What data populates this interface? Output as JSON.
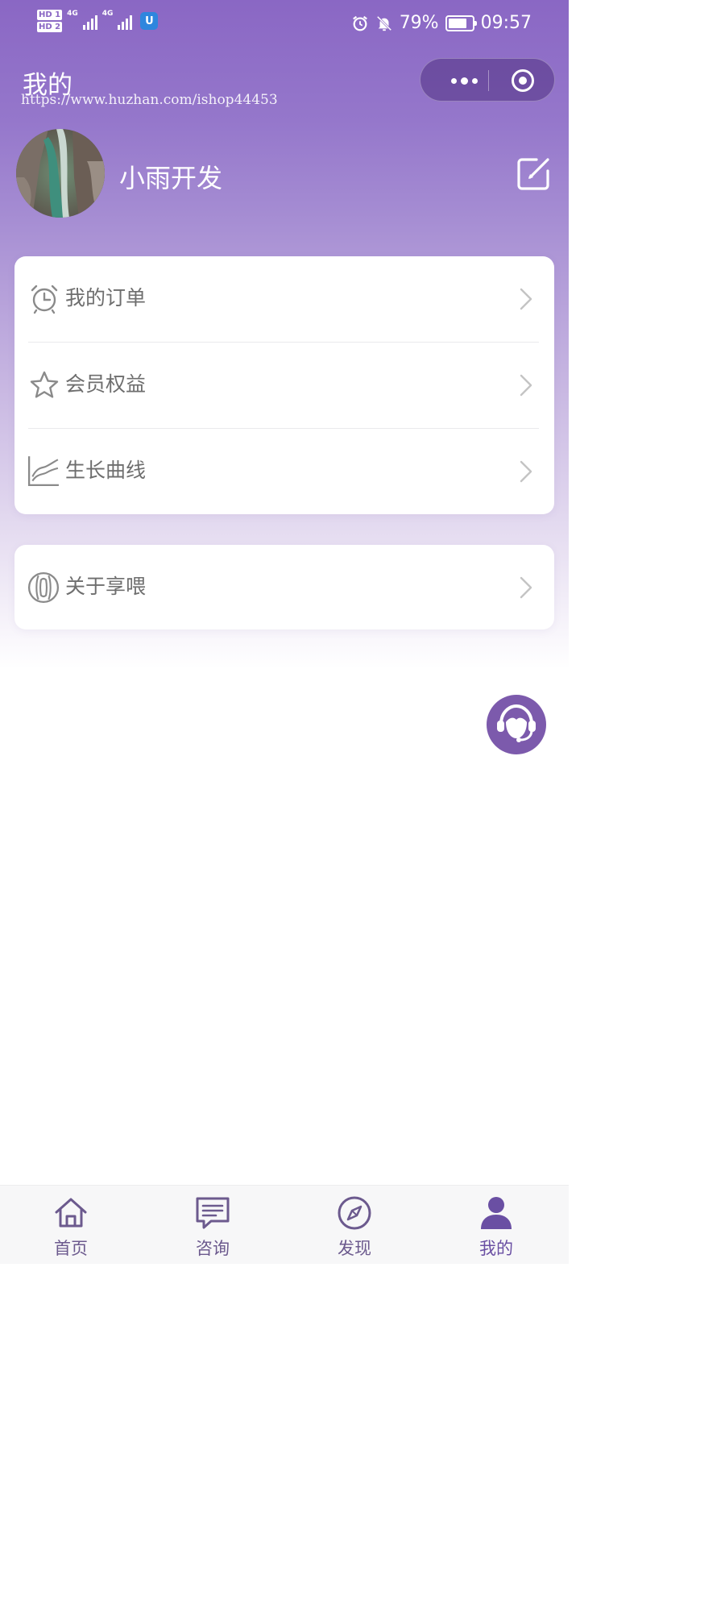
{
  "status_bar": {
    "sim1": "HD 1",
    "sim2": "HD 2",
    "net1": "4G",
    "net2": "4G",
    "battery_text": "79%",
    "battery_level": 0.79,
    "time": "09:57"
  },
  "nav": {
    "title": "我的",
    "watermark": "https://www.huzhan.com/ishop44453"
  },
  "profile": {
    "username": "小雨开发"
  },
  "menu": {
    "items": [
      {
        "label": "我的订单",
        "icon": "alarm-clock-icon"
      },
      {
        "label": "会员权益",
        "icon": "star-icon"
      },
      {
        "label": "生长曲线",
        "icon": "growth-chart-icon"
      }
    ],
    "about": {
      "label": "关于享喂",
      "icon": "brand-logo-icon"
    }
  },
  "tabbar": {
    "items": [
      {
        "label": "首页",
        "icon": "home-icon"
      },
      {
        "label": "咨询",
        "icon": "chat-icon"
      },
      {
        "label": "发现",
        "icon": "compass-icon"
      },
      {
        "label": "我的",
        "icon": "user-icon"
      }
    ],
    "active": "我的"
  },
  "colors": {
    "brand": "#8a67c4",
    "accent": "#7c5aac",
    "text_muted": "#6e6e6e"
  }
}
